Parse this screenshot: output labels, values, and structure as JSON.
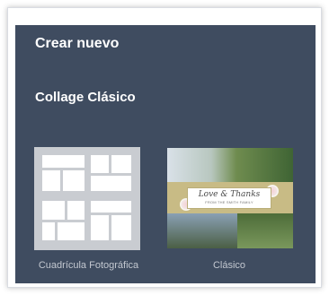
{
  "panel": {
    "title": "Crear nuevo",
    "section_title": "Collage Clásico",
    "background": "#3f4c60"
  },
  "templates": [
    {
      "label": "Cuadrícula Fotográfica",
      "thumbnail": "grid-layout"
    },
    {
      "label": "Clásico",
      "thumbnail": "photo-collage",
      "card_title": "Love & Thanks",
      "card_subtitle": "FROM THE SMITH FAMILY"
    }
  ]
}
